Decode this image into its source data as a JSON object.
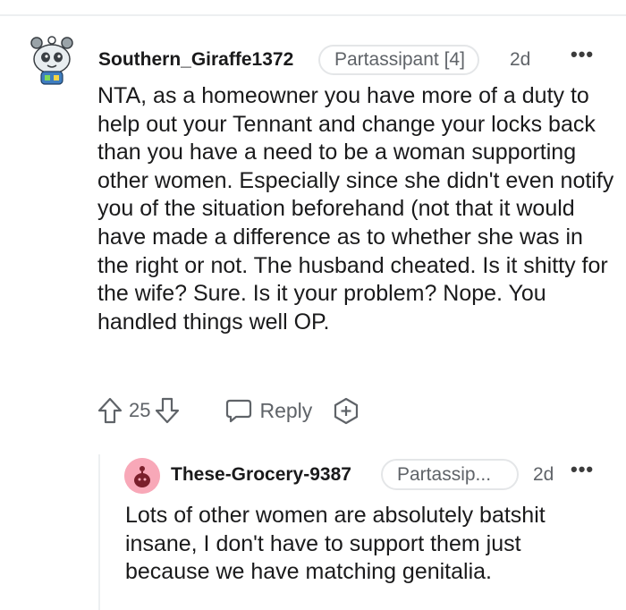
{
  "comment": {
    "username": "Southern_Giraffe1372",
    "flair": "Partassipant [4]",
    "timestamp": "2d",
    "more": "•••",
    "body": "NTA, as a homeowner you have more of a duty to help out your Tennant and change your locks back than you have a need to be a woman supporting other women. Especially since she didn't even notify you of the situation beforehand (not that it would have made a difference as to whether she was in the right or not. The husband cheated. Is it shitty for the wife? Sure. Is it your problem? Nope. You handled things well OP.",
    "votes": "25",
    "reply_label": "Reply",
    "icons": {
      "upvote": "arrow-up-icon",
      "downvote": "arrow-down-icon",
      "reply": "speech-bubble-icon",
      "award": "award-plus-icon",
      "more": "more-dots-icon"
    }
  },
  "reply": {
    "username": "These-Grocery-9387",
    "flair": "Partassip...",
    "timestamp": "2d",
    "more": "•••",
    "body": "Lots of other women are absolutely batshit insane, I don't have to support them just because we have matching genitalia."
  },
  "colors": {
    "text": "#1a1a1b",
    "meta": "#5f6368",
    "divider": "#edeff1",
    "reply_avatar_bg": "#f8a8b8"
  }
}
